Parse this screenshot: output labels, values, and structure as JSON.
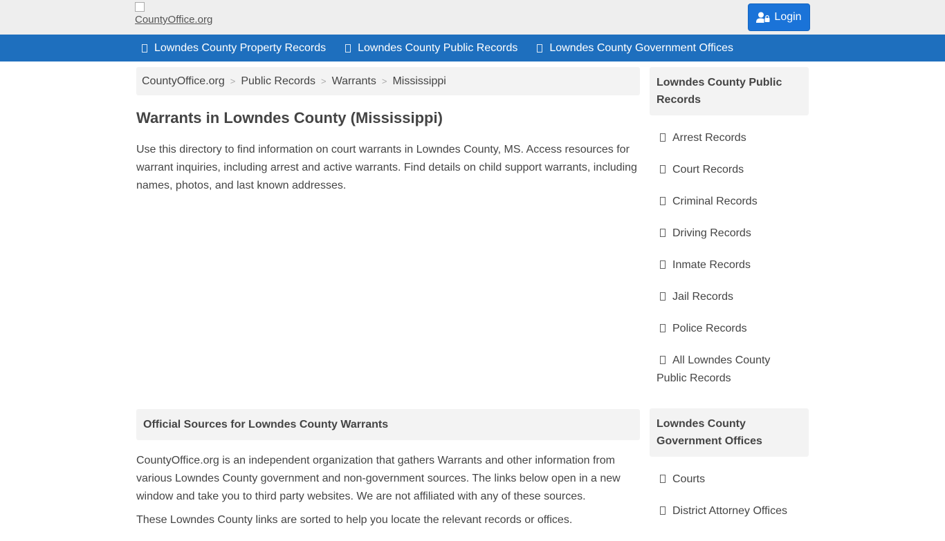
{
  "header": {
    "logo_text": "CountyOffice.org",
    "login_label": "Login"
  },
  "nav": {
    "items": [
      {
        "label": "Lowndes County Property Records"
      },
      {
        "label": "Lowndes County Public Records"
      },
      {
        "label": "Lowndes County Government Offices"
      }
    ]
  },
  "breadcrumb": {
    "items": [
      "CountyOffice.org",
      "Public Records",
      "Warrants",
      "Mississippi"
    ],
    "separator": ">"
  },
  "main": {
    "title": "Warrants in Lowndes County (Mississippi)",
    "intro": "Use this directory to find information on court warrants in Lowndes County, MS. Access resources for warrant inquiries, including arrest and active warrants. Find details on child support warrants, including names, photos, and last known addresses.",
    "section_title": "Official Sources for Lowndes County Warrants",
    "about": "CountyOffice.org is an independent organization that gathers Warrants and other information from various Lowndes County government and non-government sources. The links below open in a new window and take you to third party websites. We are not affiliated with any of these sources.",
    "about_cut": "These Lowndes County links are sorted to help you locate the relevant records or offices."
  },
  "sidebar": {
    "public_records_title": "Lowndes County Public Records",
    "public_records": [
      {
        "label": "Arrest Records"
      },
      {
        "label": "Court Records"
      },
      {
        "label": "Criminal Records"
      },
      {
        "label": "Driving Records"
      },
      {
        "label": "Inmate Records"
      },
      {
        "label": "Jail Records"
      },
      {
        "label": "Police Records"
      },
      {
        "label": "All Lowndes County Public Records"
      }
    ],
    "gov_offices_title": "Lowndes County Government Offices",
    "gov_offices": [
      {
        "label": "Courts"
      },
      {
        "label": "District Attorney Offices"
      }
    ]
  },
  "colors": {
    "nav_bg": "#1e6fbe",
    "login_bg": "#1a73d8",
    "panel_bg": "#f3f3f3"
  }
}
